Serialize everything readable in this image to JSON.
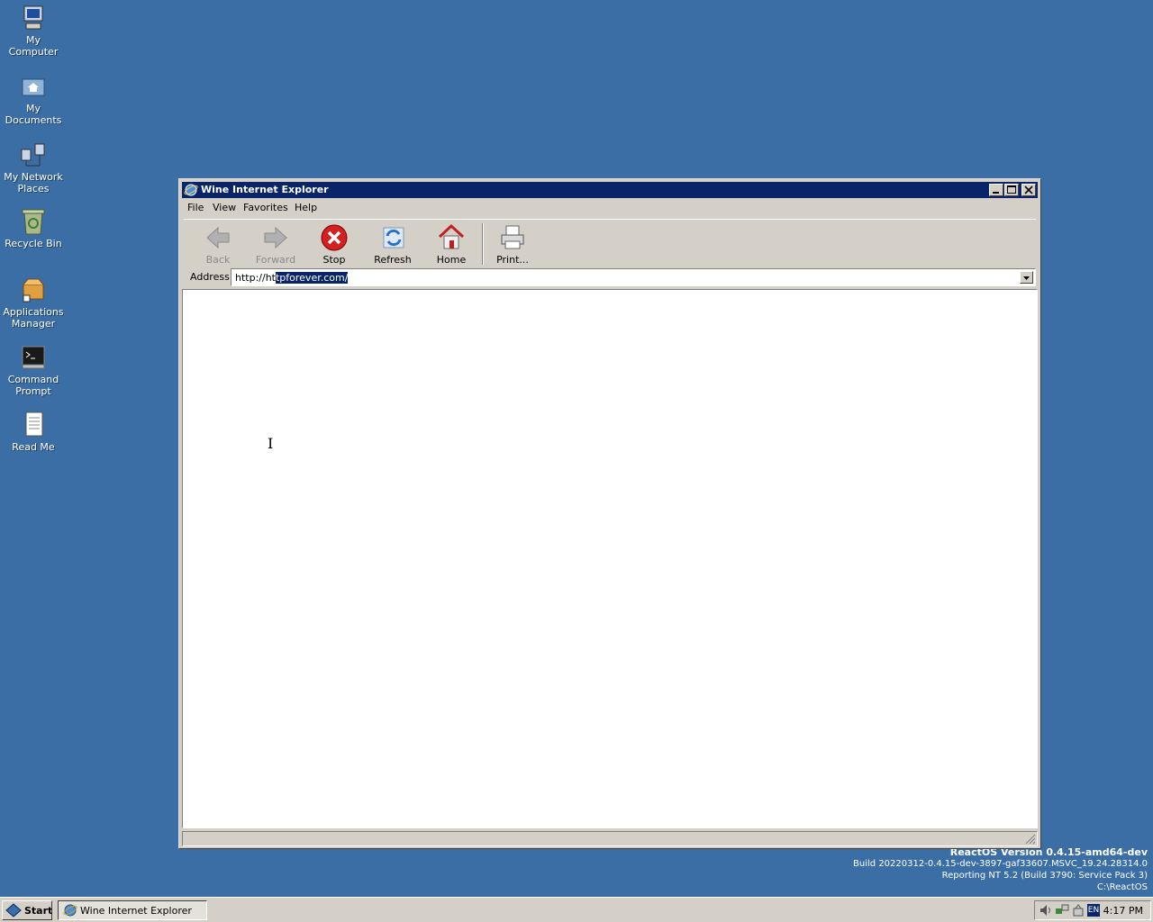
{
  "desktop": {
    "icons": [
      {
        "label": "My\nComputer"
      },
      {
        "label": "My\nDocuments"
      },
      {
        "label": "My Network\nPlaces"
      },
      {
        "label": "Recycle Bin"
      },
      {
        "label": "Applications\nManager"
      },
      {
        "label": "Command\nPrompt"
      },
      {
        "label": "Read Me"
      }
    ]
  },
  "watermark": {
    "line1": "ReactOS Version 0.4.15-amd64-dev",
    "line2": "Build 20220312-0.4.15-dev-3897-gaf33607.MSVC_19.24.28314.0",
    "line3": "Reporting NT 5.2 (Build 3790: Service Pack 3)",
    "line4": "C:\\ReactOS"
  },
  "window": {
    "title": "Wine Internet Explorer",
    "menu": [
      {
        "label": "File"
      },
      {
        "label": "View"
      },
      {
        "label": "Favorites"
      },
      {
        "label": "Help"
      }
    ],
    "toolbar": {
      "back": "Back",
      "forward": "Forward",
      "stop": "Stop",
      "refresh": "Refresh",
      "home": "Home",
      "print": "Print..."
    },
    "address": {
      "label": "Address",
      "value_plain": "http://ht",
      "value_selected": "tpforever.com/"
    }
  },
  "taskbar": {
    "start": "Start",
    "task": "Wine Internet Explorer",
    "lang": "EN",
    "clock": "4:17 PM"
  },
  "colors": {
    "desktop": "#3a6ea5",
    "titlebar": "#0a246a",
    "chrome": "#d4d0c8"
  }
}
